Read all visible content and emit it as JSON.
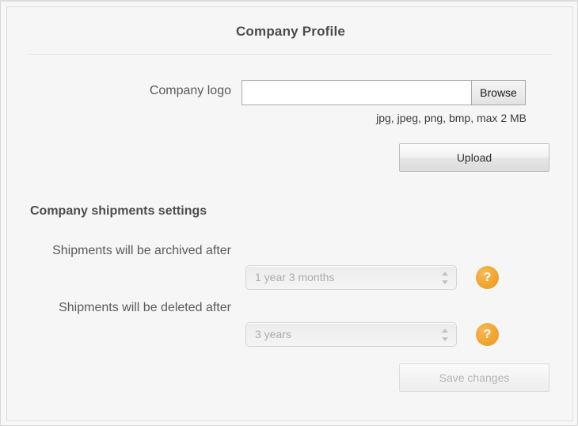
{
  "panel": {
    "title": "Company Profile"
  },
  "logo": {
    "label": "Company logo",
    "file_value": "",
    "browse_label": "Browse",
    "hint": "jpg, jpeg, png, bmp, max 2 MB",
    "upload_label": "Upload"
  },
  "shipments": {
    "heading": "Company shipments settings",
    "rows": [
      {
        "label": "Shipments will be archived after",
        "value": "1 year 3 months",
        "help_glyph": "?"
      },
      {
        "label": "Shipments will be deleted after",
        "value": "3 years",
        "help_glyph": "?"
      }
    ],
    "save_label": "Save changes"
  },
  "colors": {
    "accent_orange": "#f0a42e",
    "panel_bg": "#f6f6f6",
    "text": "#5a5a5a",
    "disabled_text": "#b6b6b6"
  }
}
